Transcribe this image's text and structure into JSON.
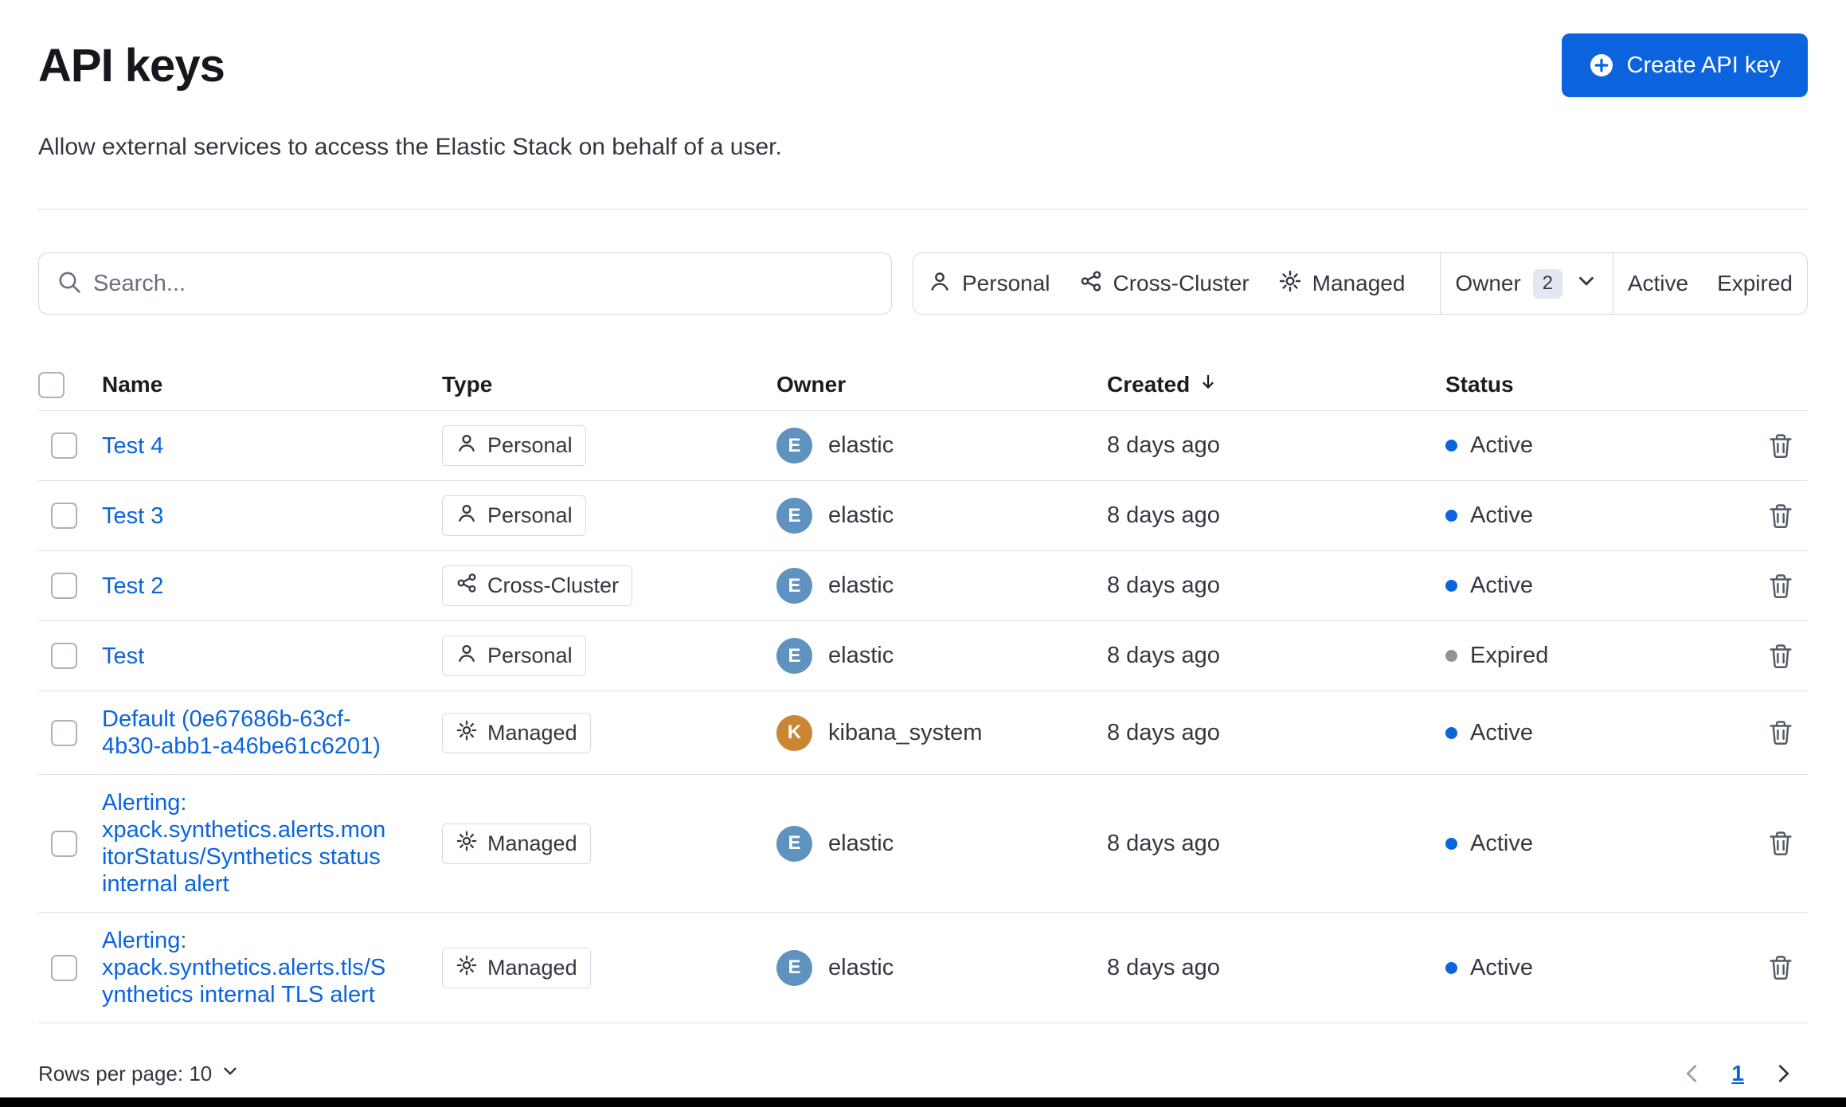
{
  "colors": {
    "accent": "#0b64dd",
    "link": "#0b64dd",
    "status_active": "#0b64dd",
    "status_expired": "#8e9299",
    "avatar_elastic": "#6092c0",
    "avatar_kibana": "#c98634"
  },
  "icons": {
    "create": "plus-in-circle",
    "search": "magnifier",
    "personal": "person",
    "cross_cluster": "linked-nodes",
    "managed": "gear",
    "owner_dropdown": "chevron-down",
    "created_sort": "arrow-down",
    "delete": "trash",
    "prev_page": "chevron-left",
    "next_page": "chevron-right"
  },
  "header": {
    "title": "API keys",
    "subtitle": "Allow external services to access the Elastic Stack on behalf of a user.",
    "create_button_label": "Create API key"
  },
  "toolbar": {
    "search_placeholder": "Search...",
    "filters": {
      "personal": "Personal",
      "cross_cluster": "Cross-Cluster",
      "managed": "Managed",
      "owner_label": "Owner",
      "owner_count": "2",
      "active": "Active",
      "expired": "Expired"
    }
  },
  "table": {
    "headers": {
      "name": "Name",
      "type": "Type",
      "owner": "Owner",
      "created": "Created",
      "status": "Status"
    },
    "rows": [
      {
        "name": "Test 4",
        "type": "Personal",
        "owner": "elastic",
        "owner_initial": "E",
        "created": "8 days ago",
        "status": "Active"
      },
      {
        "name": "Test 3",
        "type": "Personal",
        "owner": "elastic",
        "owner_initial": "E",
        "created": "8 days ago",
        "status": "Active"
      },
      {
        "name": "Test 2",
        "type": "Cross-Cluster",
        "owner": "elastic",
        "owner_initial": "E",
        "created": "8 days ago",
        "status": "Active"
      },
      {
        "name": "Test",
        "type": "Personal",
        "owner": "elastic",
        "owner_initial": "E",
        "created": "8 days ago",
        "status": "Expired"
      },
      {
        "name": "Default (0e67686b-63cf-4b30-abb1-a46be61c6201)",
        "type": "Managed",
        "owner": "kibana_system",
        "owner_initial": "K",
        "created": "8 days ago",
        "status": "Active"
      },
      {
        "name": "Alerting: xpack.synthetics.alerts.monitorStatus/Synthetics status internal alert",
        "type": "Managed",
        "owner": "elastic",
        "owner_initial": "E",
        "created": "8 days ago",
        "status": "Active"
      },
      {
        "name": "Alerting: xpack.synthetics.alerts.tls/Synthetics internal TLS alert",
        "type": "Managed",
        "owner": "elastic",
        "owner_initial": "E",
        "created": "8 days ago",
        "status": "Active"
      }
    ]
  },
  "footer": {
    "rows_per_page_label": "Rows per page: 10",
    "current_page": "1"
  }
}
